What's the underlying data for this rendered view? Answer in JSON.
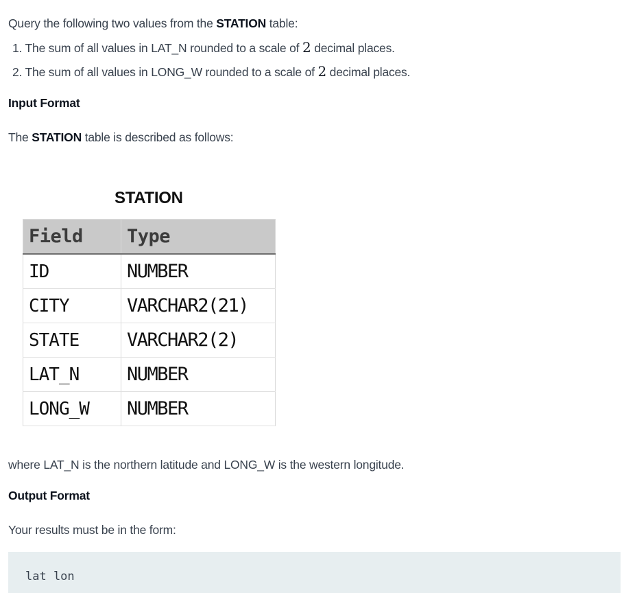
{
  "intro": {
    "prefix": "Query the following two values from the ",
    "table_name": "STATION",
    "suffix": " table:"
  },
  "requirements": [
    {
      "number": "1.",
      "text_before": " The sum of all values in LAT_N rounded to a scale of ",
      "value": "2",
      "text_after": " decimal places."
    },
    {
      "number": "2.",
      "text_before": " The sum of all values in LONG_W rounded to a scale of ",
      "value": "2",
      "text_after": " decimal places."
    }
  ],
  "input_format": {
    "heading": "Input Format",
    "desc_prefix": "The ",
    "desc_table": "STATION",
    "desc_suffix": " table is described as follows:"
  },
  "station_table": {
    "caption": "STATION",
    "headers": [
      "Field",
      "Type"
    ],
    "rows": [
      {
        "field": "ID",
        "type": "NUMBER"
      },
      {
        "field": "CITY",
        "type": "VARCHAR2(21)"
      },
      {
        "field": "STATE",
        "type": "VARCHAR2(2)"
      },
      {
        "field": "LAT_N",
        "type": "NUMBER"
      },
      {
        "field": "LONG_W",
        "type": "NUMBER"
      }
    ]
  },
  "where_text": "where LAT_N is the northern latitude and LONG_W is the western longitude.",
  "output_format": {
    "heading": "Output Format",
    "desc": "Your results must be in the form:",
    "code": "lat lon"
  }
}
